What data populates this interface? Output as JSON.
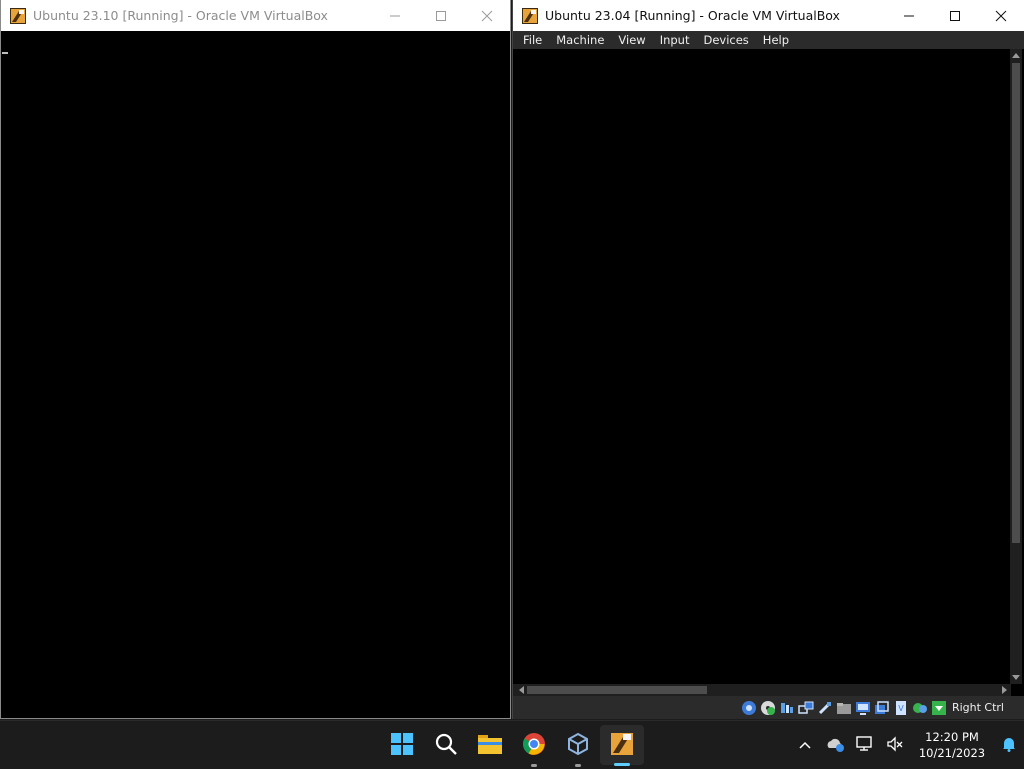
{
  "left_window": {
    "title": "Ubuntu 23.10 [Running] - Oracle VM VirtualBox"
  },
  "right_window": {
    "title": "Ubuntu 23.04 [Running] - Oracle VM VirtualBox",
    "menu": [
      "File",
      "Machine",
      "View",
      "Input",
      "Devices",
      "Help"
    ],
    "status": {
      "icons": [
        "hard-disk-icon",
        "optical-disk-icon",
        "audio-icon",
        "network-icon",
        "usb-icon",
        "shared-folders-icon",
        "display-icon",
        "recording-icon",
        "cpu-icon",
        "virtualization-icon",
        "arrow-down-icon"
      ],
      "host_key": "Right Ctrl"
    }
  },
  "taskbar": {
    "apps": [
      "start-icon",
      "search-icon",
      "file-explorer-icon",
      "chrome-icon",
      "virtualbox-manager-icon",
      "virtualbox-vm-icon"
    ],
    "clock": {
      "time": "12:20 PM",
      "date": "10/21/2023"
    }
  },
  "colors": {
    "title_active": "#111111",
    "title_inactive": "#8c8c8c",
    "menubar": "#2b2b2b",
    "taskbar": "#1c1c1c",
    "accent": "#60cdff"
  }
}
